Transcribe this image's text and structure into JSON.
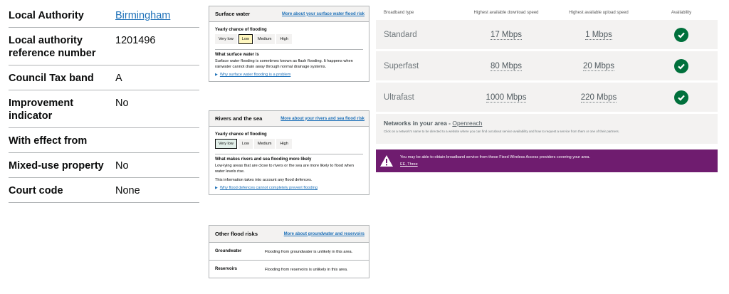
{
  "council": {
    "rows": [
      {
        "label": "Local Authority",
        "value": "Birmingham"
      },
      {
        "label": "Local authority reference number",
        "value": "1201496"
      },
      {
        "label": "Council Tax band",
        "value": "A"
      },
      {
        "label": "Improvement indicator",
        "value": "No"
      },
      {
        "label": "With effect from",
        "value": ""
      },
      {
        "label": "Mixed-use property",
        "value": "No"
      },
      {
        "label": "Court code",
        "value": "None"
      }
    ]
  },
  "flood": {
    "surface_water": {
      "title": "Surface water",
      "link": "More about your surface water flood risk",
      "chance_label": "Yearly chance of flooding",
      "levels": [
        "Very low",
        "Low",
        "Medium",
        "High"
      ],
      "selected": "Low",
      "what_title": "What surface water is",
      "what_text": "Surface water flooding is sometimes known as flash flooding. It happens when rainwater cannot drain away through normal drainage systems.",
      "details": "Why surface water flooding is a problem"
    },
    "rivers_sea": {
      "title": "Rivers and the sea",
      "link": "More about your rivers and sea flood risk",
      "chance_label": "Yearly chance of flooding",
      "levels": [
        "Very low",
        "Low",
        "Medium",
        "High"
      ],
      "selected": "Very low",
      "what_title": "What makes rivers and sea flooding more likely",
      "what_text": "Low-lying areas that are close to rivers or the sea are more likely to flood when water levels rise.",
      "what_text2": "This information takes into account any flood defences.",
      "details": "Why flood defences cannot completely prevent flooding"
    },
    "other": {
      "title": "Other flood risks",
      "link": "More about groundwater and reservoirs",
      "rows": [
        {
          "label": "Groundwater",
          "value": "Flooding from groundwater is unlikely in this area."
        },
        {
          "label": "Reservoirs",
          "value": "Flooding from reservoirs is unlikely in this area."
        }
      ]
    }
  },
  "broadband": {
    "headers": {
      "type": "Broadband type",
      "download": "Highest available download speed",
      "upload": "Highest available upload speed",
      "availability": "Availability"
    },
    "rows": [
      {
        "type": "Standard",
        "download": "17 Mbps",
        "upload": "1 Mbps"
      },
      {
        "type": "Superfast",
        "download": "80 Mbps",
        "upload": "20 Mbps"
      },
      {
        "type": "Ultrafast",
        "download": "1000 Mbps",
        "upload": "220 Mbps"
      }
    ],
    "networks": {
      "title": "Networks in your area - ",
      "link": "Openreach",
      "desc": "Click on a network's name to be directed to a website where you can find out about service availability and how to request a service from them or one of their partners."
    },
    "warning": {
      "message": "You may be able to obtain broadband service from these Fixed Wireless Access providers covering your area.",
      "link": "EE, Three"
    },
    "icons": {
      "available": "check-circle-icon",
      "warning": "warning-triangle-icon"
    },
    "colors": {
      "check": "#00703c",
      "warning_bg": "#6f1c6f"
    }
  }
}
